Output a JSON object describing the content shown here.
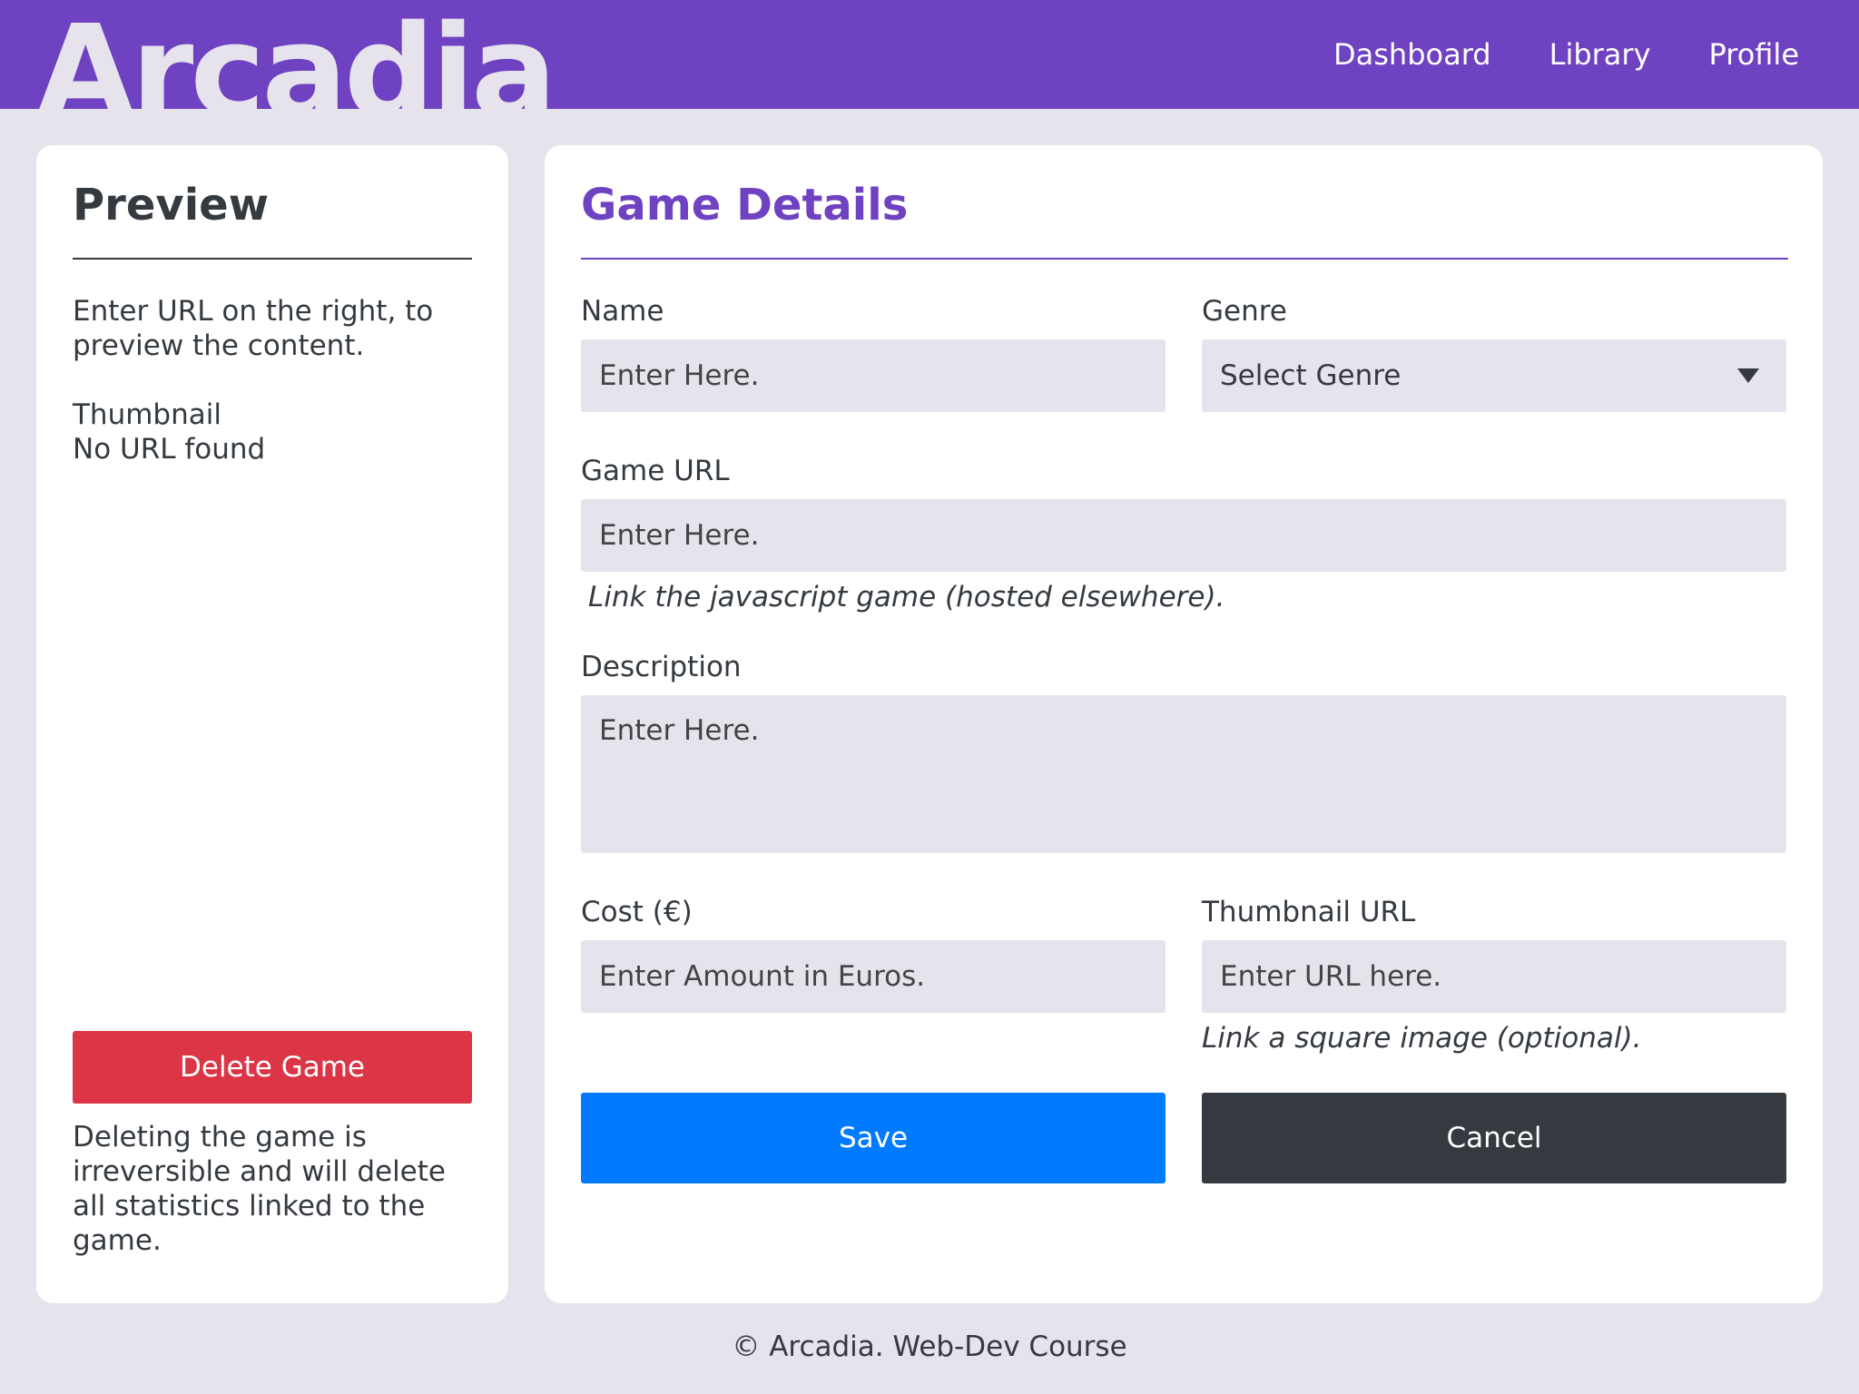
{
  "app": {
    "logo": "Arcadia",
    "accent": "#6f42c1"
  },
  "nav": {
    "dashboard": "Dashboard",
    "library": "Library",
    "profile": "Profile"
  },
  "preview": {
    "title": "Preview",
    "intro": "Enter URL on the right, to preview the content.",
    "thumbnail_label": "Thumbnail",
    "thumbnail_status": "No URL found",
    "delete_label": "Delete Game",
    "delete_warning": "Deleting the game is irreversible and will delete all statistics linked to the game."
  },
  "form": {
    "title": "Game Details",
    "name": {
      "label": "Name",
      "placeholder": "Enter Here."
    },
    "genre": {
      "label": "Genre",
      "selected": "Select Genre"
    },
    "game_url": {
      "label": "Game URL",
      "placeholder": "Enter Here.",
      "help": "Link the javascript game (hosted elsewhere)."
    },
    "description": {
      "label": "Description",
      "placeholder": "Enter Here."
    },
    "cost": {
      "label": "Cost (€)",
      "placeholder": "Enter Amount in Euros."
    },
    "thumbnail_url": {
      "label": "Thumbnail URL",
      "placeholder": "Enter URL here.",
      "help": "Link a square image (optional)."
    },
    "save_label": "Save",
    "cancel_label": "Cancel"
  },
  "footer": {
    "text": "© Arcadia. Web-Dev Course"
  },
  "colors": {
    "danger": "#dc3545",
    "primary": "#007bff",
    "dark": "#343a40",
    "background": "#e6e3ec"
  }
}
